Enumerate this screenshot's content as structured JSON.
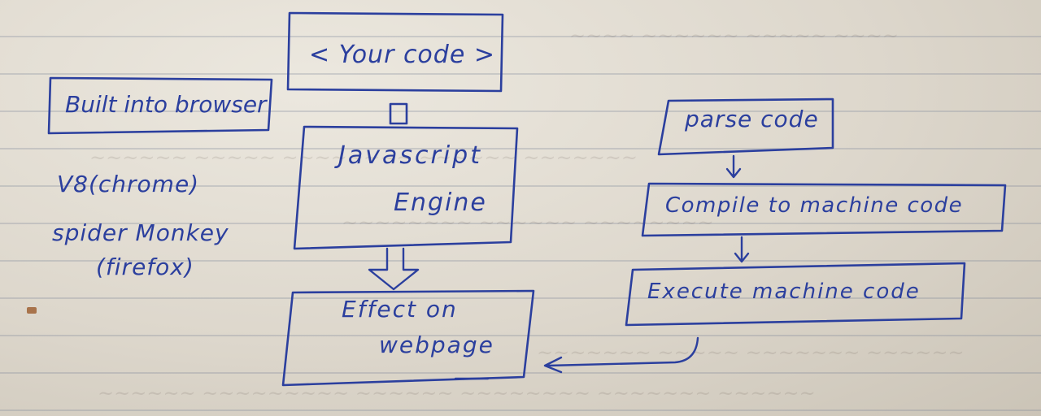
{
  "diagram": {
    "your_code": "< Your code >",
    "engine_line1": "Javascript",
    "engine_line2": "Engine",
    "effect_line1": "Effect on",
    "effect_line2": "webpage",
    "built_into": "Built into browser",
    "v8": "V8(chrome)",
    "spider_line1": "spider Monkey",
    "spider_line2": "(firefox)",
    "parse": "parse code",
    "compile": "Compile to machine code",
    "execute": "Execute machine code"
  },
  "colors": {
    "ink": "#2b3f9e",
    "paper": "#e4dfd5"
  }
}
